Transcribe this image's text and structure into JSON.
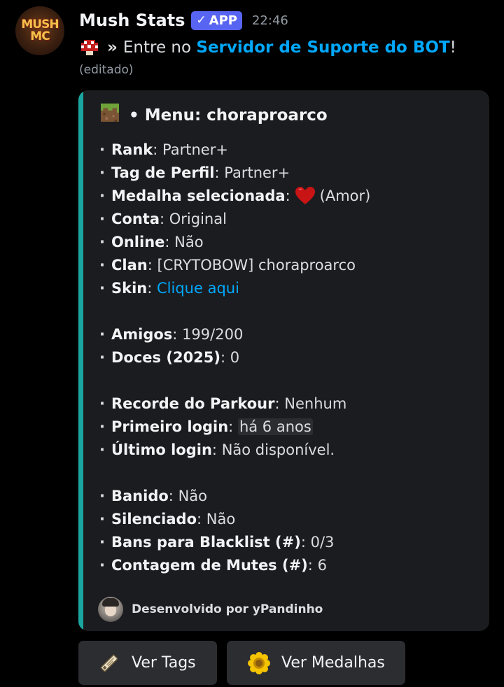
{
  "message": {
    "author": "Mush Stats",
    "app_badge": "APP",
    "timestamp": "22:46",
    "content": {
      "prefix": "»",
      "text_before": "Entre no",
      "link_text": "Servidor de Suporte do BOT",
      "text_after": "!"
    },
    "edited": "(editado)"
  },
  "avatar": {
    "logo_line1": "MUSH",
    "logo_line2": "MC"
  },
  "embed": {
    "accent_color": "#1aa5a0",
    "title_separator": "•",
    "title": "Menu: choraproarco",
    "bullet": "·",
    "fields": [
      {
        "label": "Rank",
        "value": "Partner+"
      },
      {
        "label": "Tag de Perfil",
        "value": "Partner+"
      },
      {
        "label": "Medalha selecionada",
        "value": "(Amor)",
        "icon": "heart-icon"
      },
      {
        "label": "Conta",
        "value": "Original"
      },
      {
        "label": "Online",
        "value": "Não"
      },
      {
        "label": "Clan",
        "value": "[CRYTOBOW] choraproarco"
      },
      {
        "label": "Skin",
        "value": "Clique aqui",
        "link": true
      },
      {
        "label": "Amigos",
        "value": "199/200"
      },
      {
        "label": "Doces (2025)",
        "value": "0"
      },
      {
        "label": "Recorde do Parkour",
        "value": "Nenhum"
      },
      {
        "label": "Primeiro login",
        "value": "há 6 anos",
        "highlight": true
      },
      {
        "label": "Último login",
        "value": "Não disponível."
      },
      {
        "label": "Banido",
        "value": "Não"
      },
      {
        "label": "Silenciado",
        "value": "Não"
      },
      {
        "label": "Bans para Blacklist (#)",
        "value": "0/3"
      },
      {
        "label": "Contagem de Mutes (#)",
        "value": "6"
      }
    ],
    "footer": "Desenvolvido por yPandinho"
  },
  "buttons": [
    {
      "label": "Ver Tags",
      "icon": "name-tag-icon"
    },
    {
      "label": "Ver Medalhas",
      "icon": "sunflower-icon"
    }
  ],
  "colors": {
    "background": "#000000",
    "embed_background": "#1b1c20",
    "link": "#00a8fc",
    "app_badge": "#5865f2",
    "button_background": "#2b2d31"
  }
}
